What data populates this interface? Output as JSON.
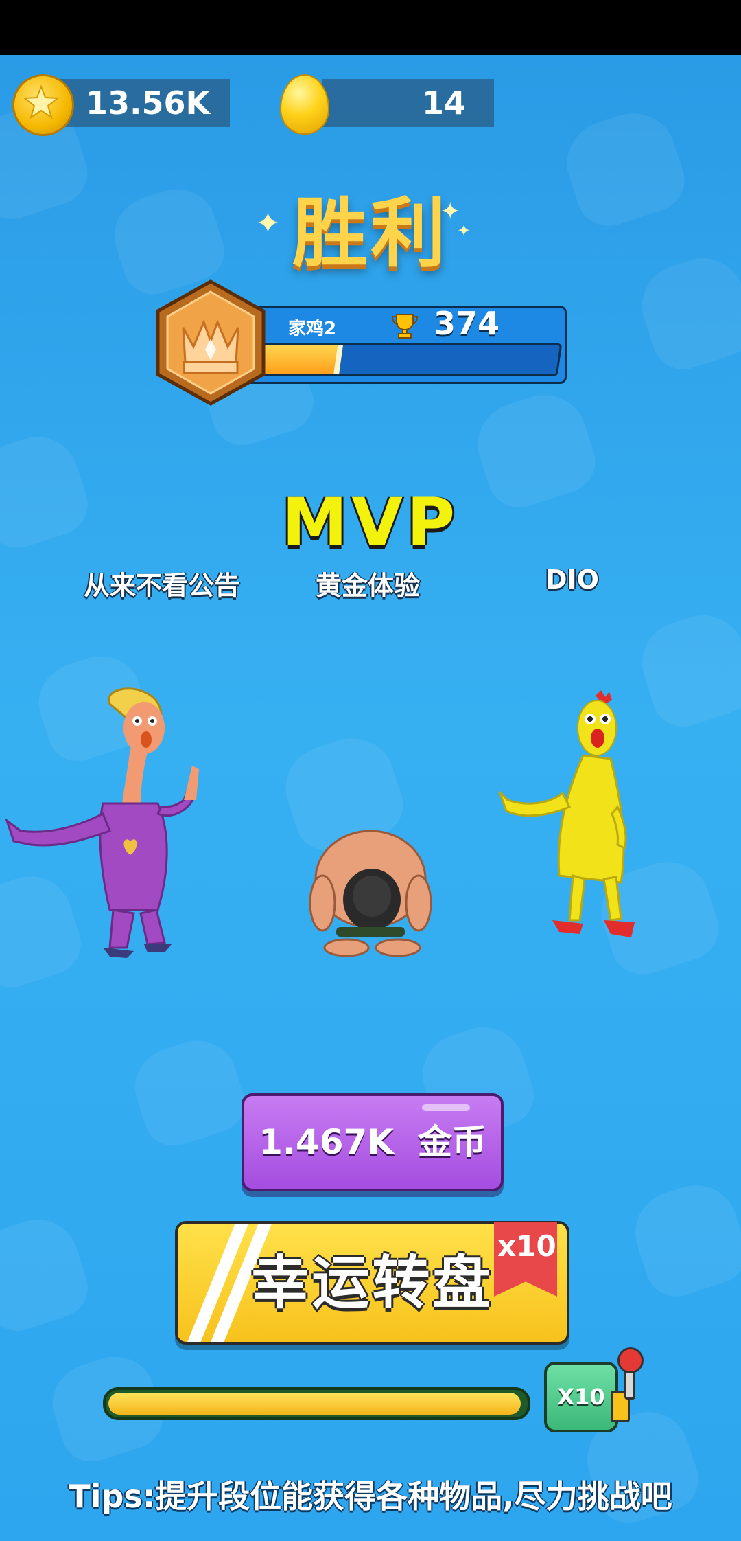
{
  "currency": {
    "stars_value": "13.56K",
    "gems_value": "14",
    "star_icon": "gold-star-coin-icon",
    "gem_icon": "gold-egg-icon"
  },
  "result": {
    "title": "胜利"
  },
  "rank": {
    "tier_name": "家鸡2",
    "trophies": "374",
    "progress": 0.28,
    "badge_icon": "crown-hexagon-badge-icon",
    "trophy_icon": "trophy-icon"
  },
  "mvp_label": "MVP",
  "players": [
    {
      "name": "从来不看公告"
    },
    {
      "name": "黄金体验"
    },
    {
      "name": "DIO"
    }
  ],
  "rewards": {
    "coins_label": "1.467K  金币",
    "wheel_label": "幸运转盘",
    "wheel_multiplier": "x10",
    "spin_label": "X10",
    "spin_progress": 0.99
  },
  "tips": "Tips:提升段位能获得各种物品,尽力挑战吧",
  "colors": {
    "background": "#2fa8ec",
    "accent_gold": "#ffd34a",
    "mvp_yellow": "#f2f20d",
    "coins_button": "#a54de0",
    "wheel_button": "#f7c21c",
    "spin_button": "#3cb879"
  }
}
